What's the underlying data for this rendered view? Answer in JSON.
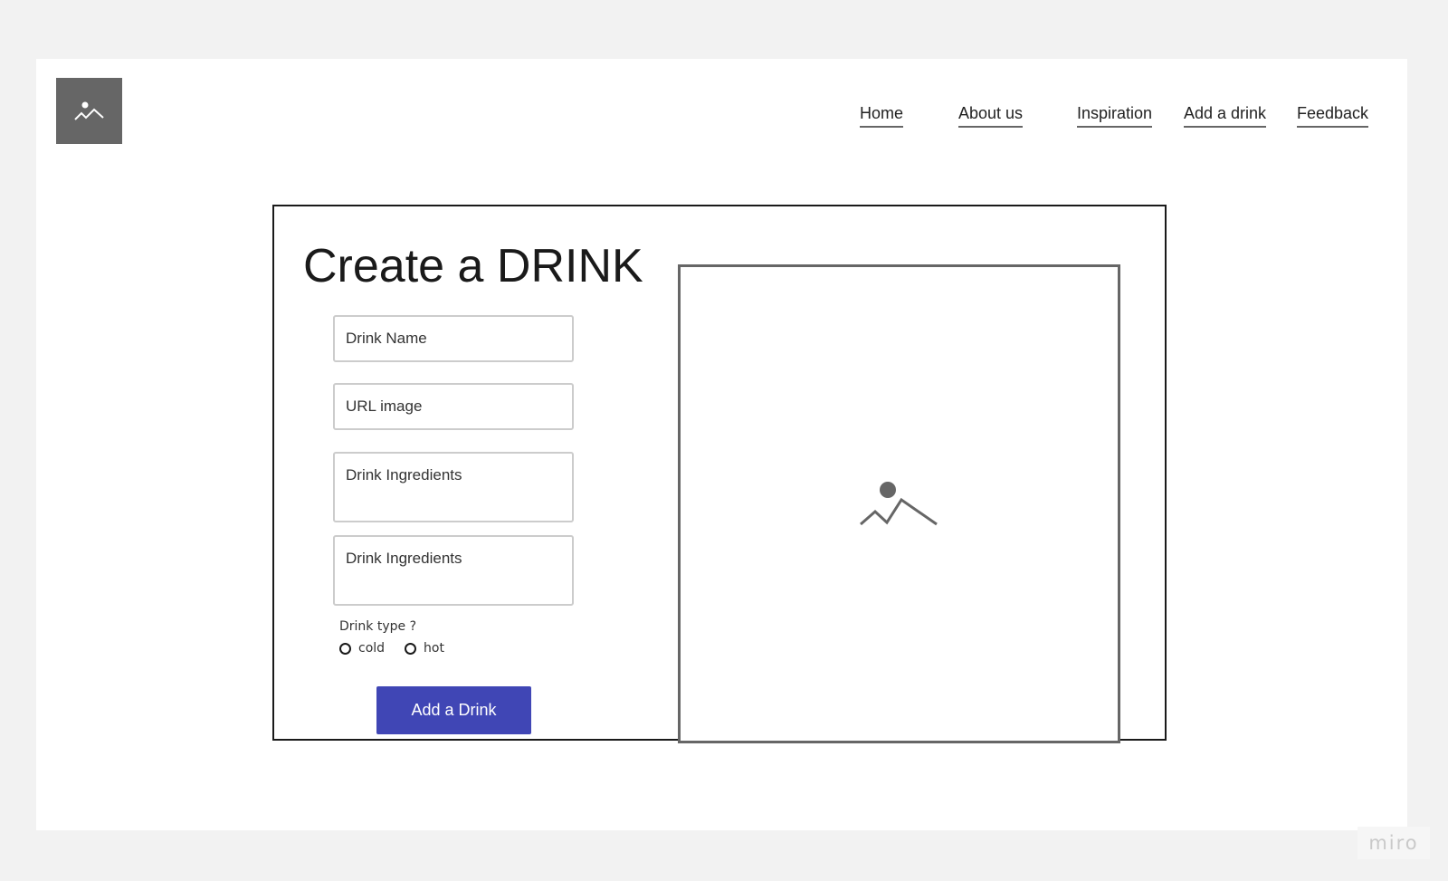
{
  "header": {
    "logo_icon": "image-placeholder-icon",
    "nav": [
      {
        "label": "Home"
      },
      {
        "label": "About us"
      },
      {
        "label": "Inspiration"
      },
      {
        "label": "Add a drink"
      },
      {
        "label": "Feedback"
      }
    ]
  },
  "form": {
    "title": "Create a DRINK",
    "fields": {
      "drink_name": "Drink Name",
      "url_image": "URL image",
      "ingredients_1": "Drink Ingredients",
      "ingredients_2": "Drink Ingredients"
    },
    "drink_type_label": "Drink type ?",
    "options": [
      {
        "label": "cold"
      },
      {
        "label": "hot"
      }
    ],
    "submit_label": "Add a Drink"
  },
  "preview": {
    "icon": "image-placeholder-icon"
  },
  "watermark": "miro",
  "colors": {
    "accent": "#4046b5",
    "placeholder": "#666666",
    "background": "#f2f2f2"
  }
}
